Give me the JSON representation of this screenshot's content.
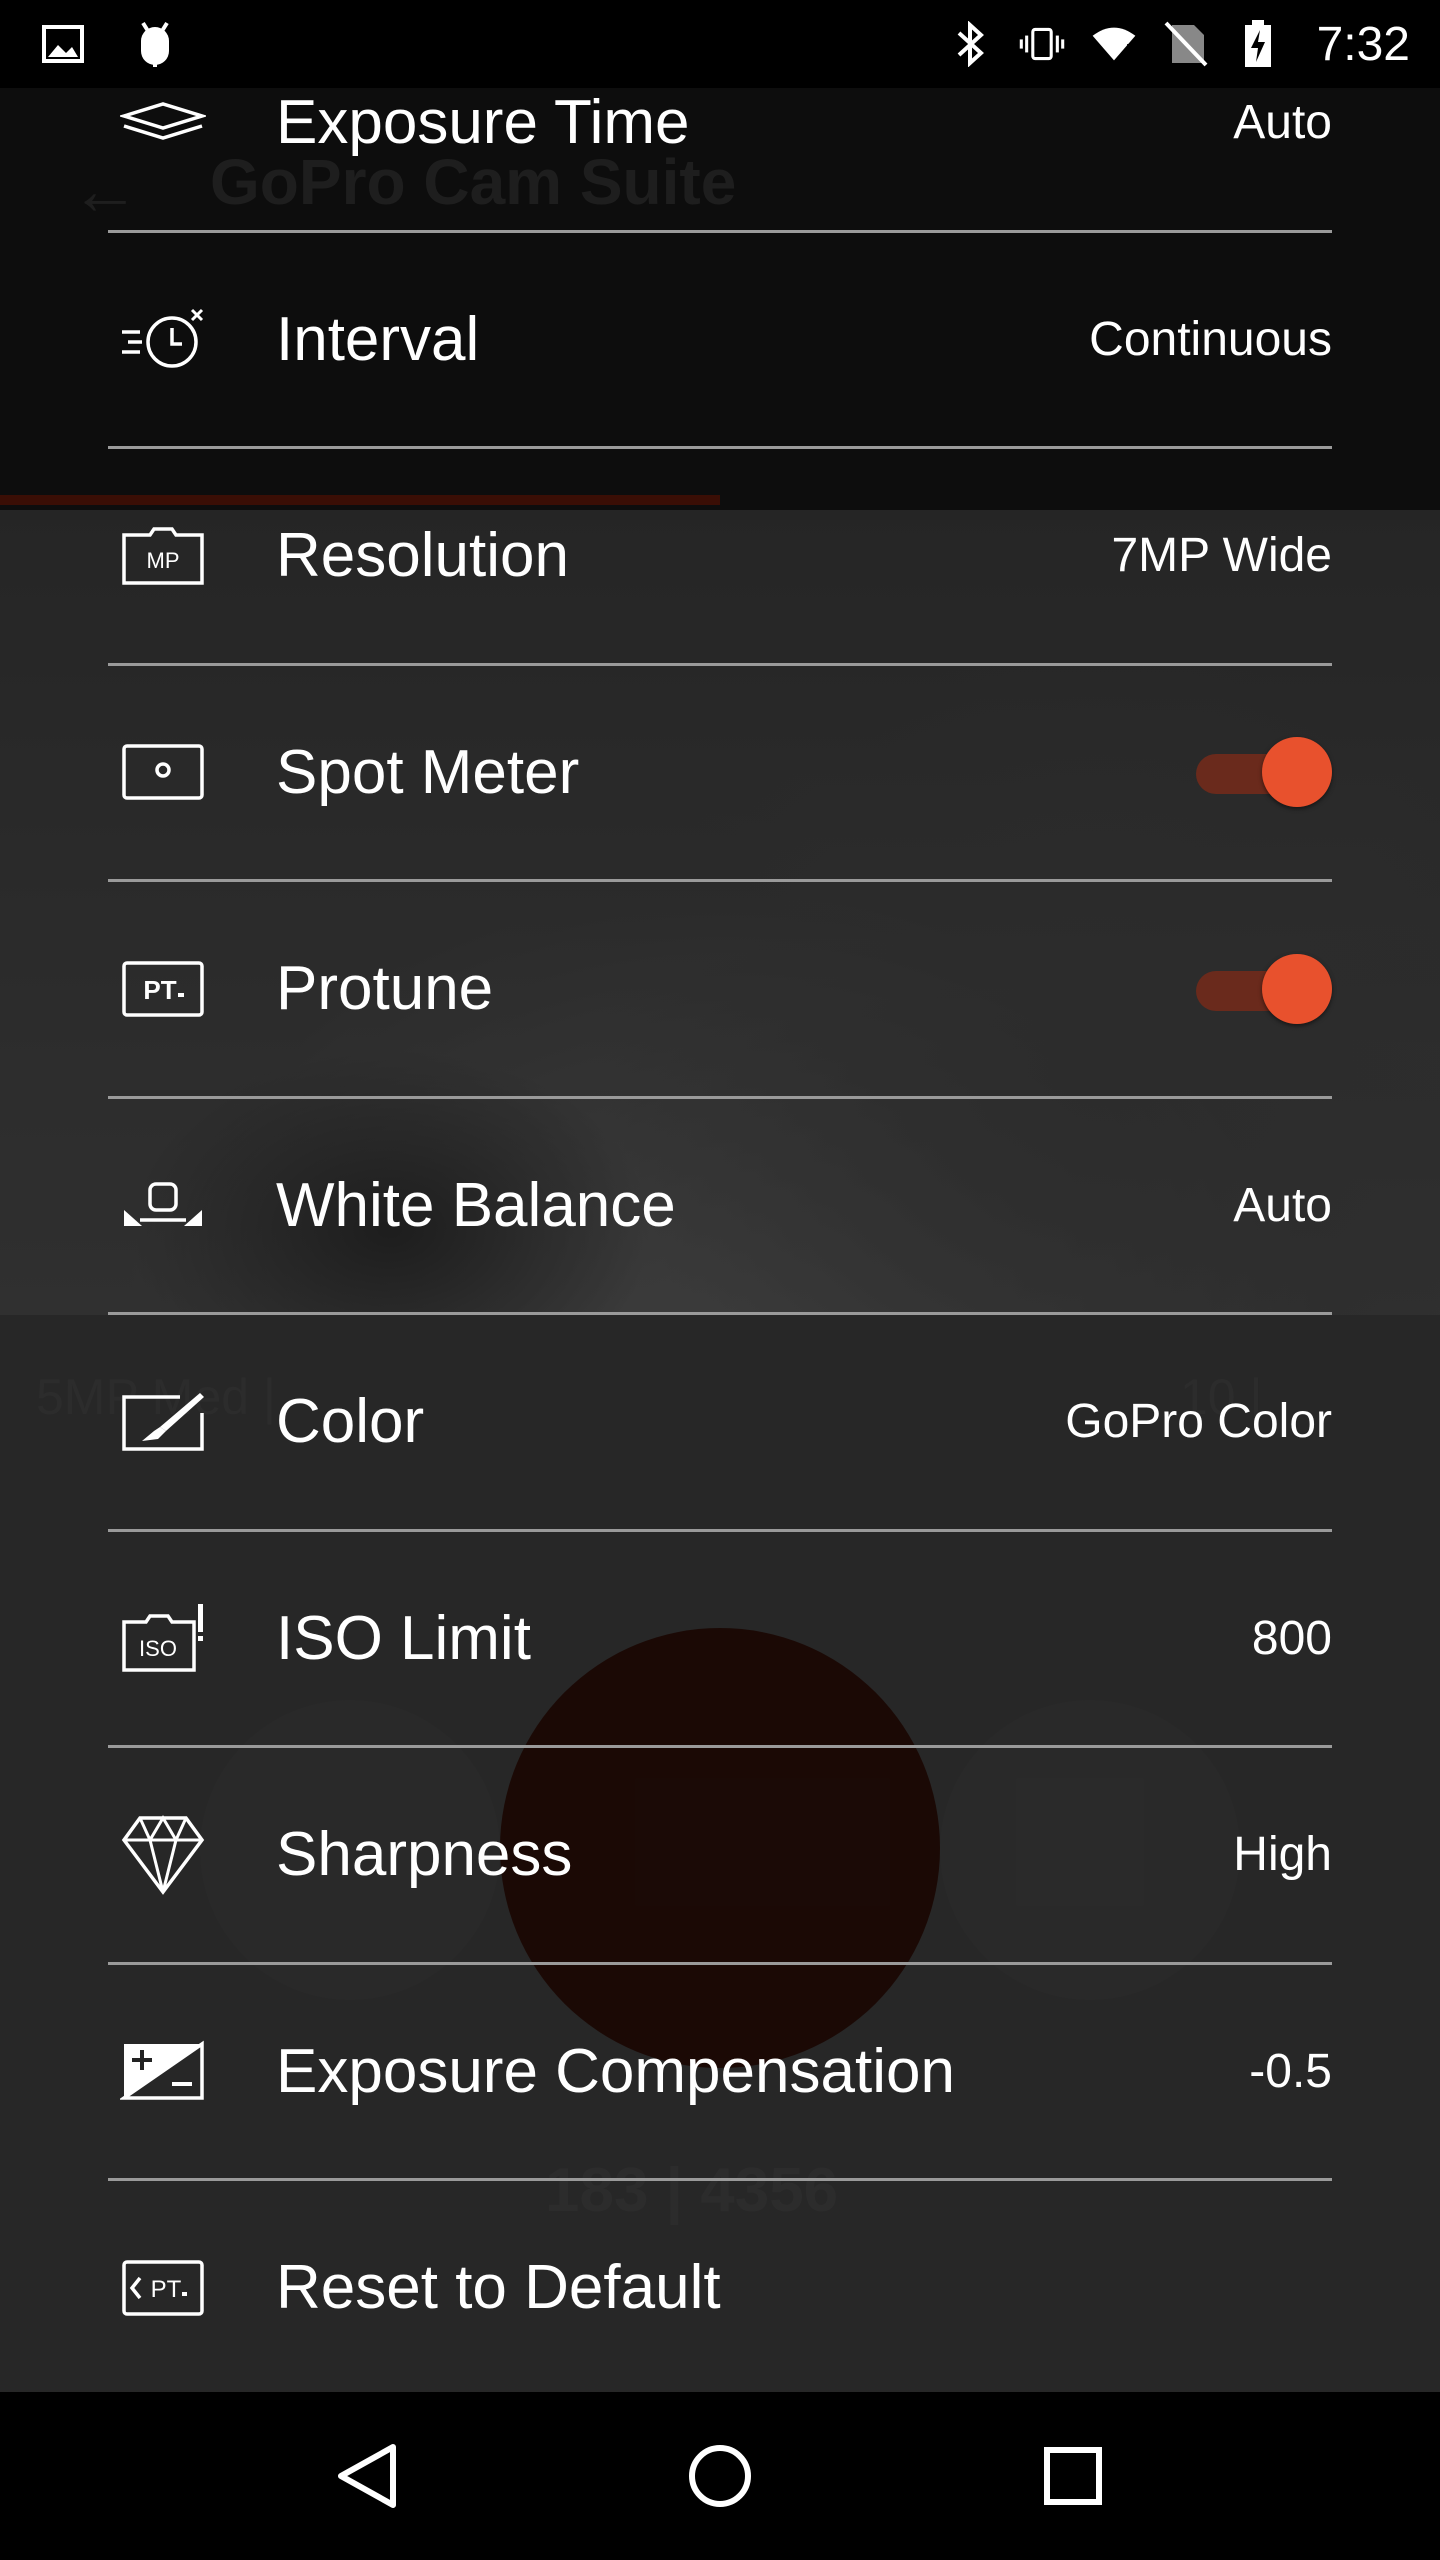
{
  "status_bar": {
    "time": "7:32",
    "left_icons": [
      "image-notification-icon",
      "android-debug-icon"
    ],
    "right_icons": [
      "bluetooth-icon",
      "vibrate-icon",
      "wifi-icon",
      "no-sim-icon",
      "battery-charging-icon"
    ]
  },
  "background_app": {
    "title": "GoPro Cam Suite",
    "sub_left": "5MP Med |",
    "sub_right": "10 |",
    "counter": "183 | 4356"
  },
  "colors": {
    "accent": "#e8512d",
    "toggle_track": "#6a2a1c",
    "divider": "#9a9a9a"
  },
  "settings": [
    {
      "icon": "layers-icon",
      "label": "Exposure Time",
      "value": "Auto",
      "type": "value"
    },
    {
      "icon": "interval-timer-icon",
      "label": "Interval",
      "value": "Continuous",
      "type": "value"
    },
    {
      "icon": "megapixel-icon",
      "label": "Resolution",
      "value": "7MP Wide",
      "type": "value"
    },
    {
      "icon": "spot-meter-icon",
      "label": "Spot Meter",
      "value": "on",
      "type": "toggle"
    },
    {
      "icon": "protune-icon",
      "label": "Protune",
      "value": "on",
      "type": "toggle"
    },
    {
      "icon": "white-balance-icon",
      "label": "White Balance",
      "value": "Auto",
      "type": "value"
    },
    {
      "icon": "color-brush-icon",
      "label": "Color",
      "value": "GoPro Color",
      "type": "value"
    },
    {
      "icon": "iso-limit-icon",
      "label": "ISO Limit",
      "value": "800",
      "type": "value"
    },
    {
      "icon": "diamond-icon",
      "label": "Sharpness",
      "value": "High",
      "type": "value"
    },
    {
      "icon": "exposure-compensation-icon",
      "label": "Exposure Compensation",
      "value": "-0.5",
      "type": "value"
    },
    {
      "icon": "reset-protune-icon",
      "label": "Reset to Default",
      "value": "",
      "type": "action"
    }
  ],
  "nav_bar": {
    "buttons": [
      "back-icon",
      "home-icon",
      "recents-icon"
    ]
  }
}
